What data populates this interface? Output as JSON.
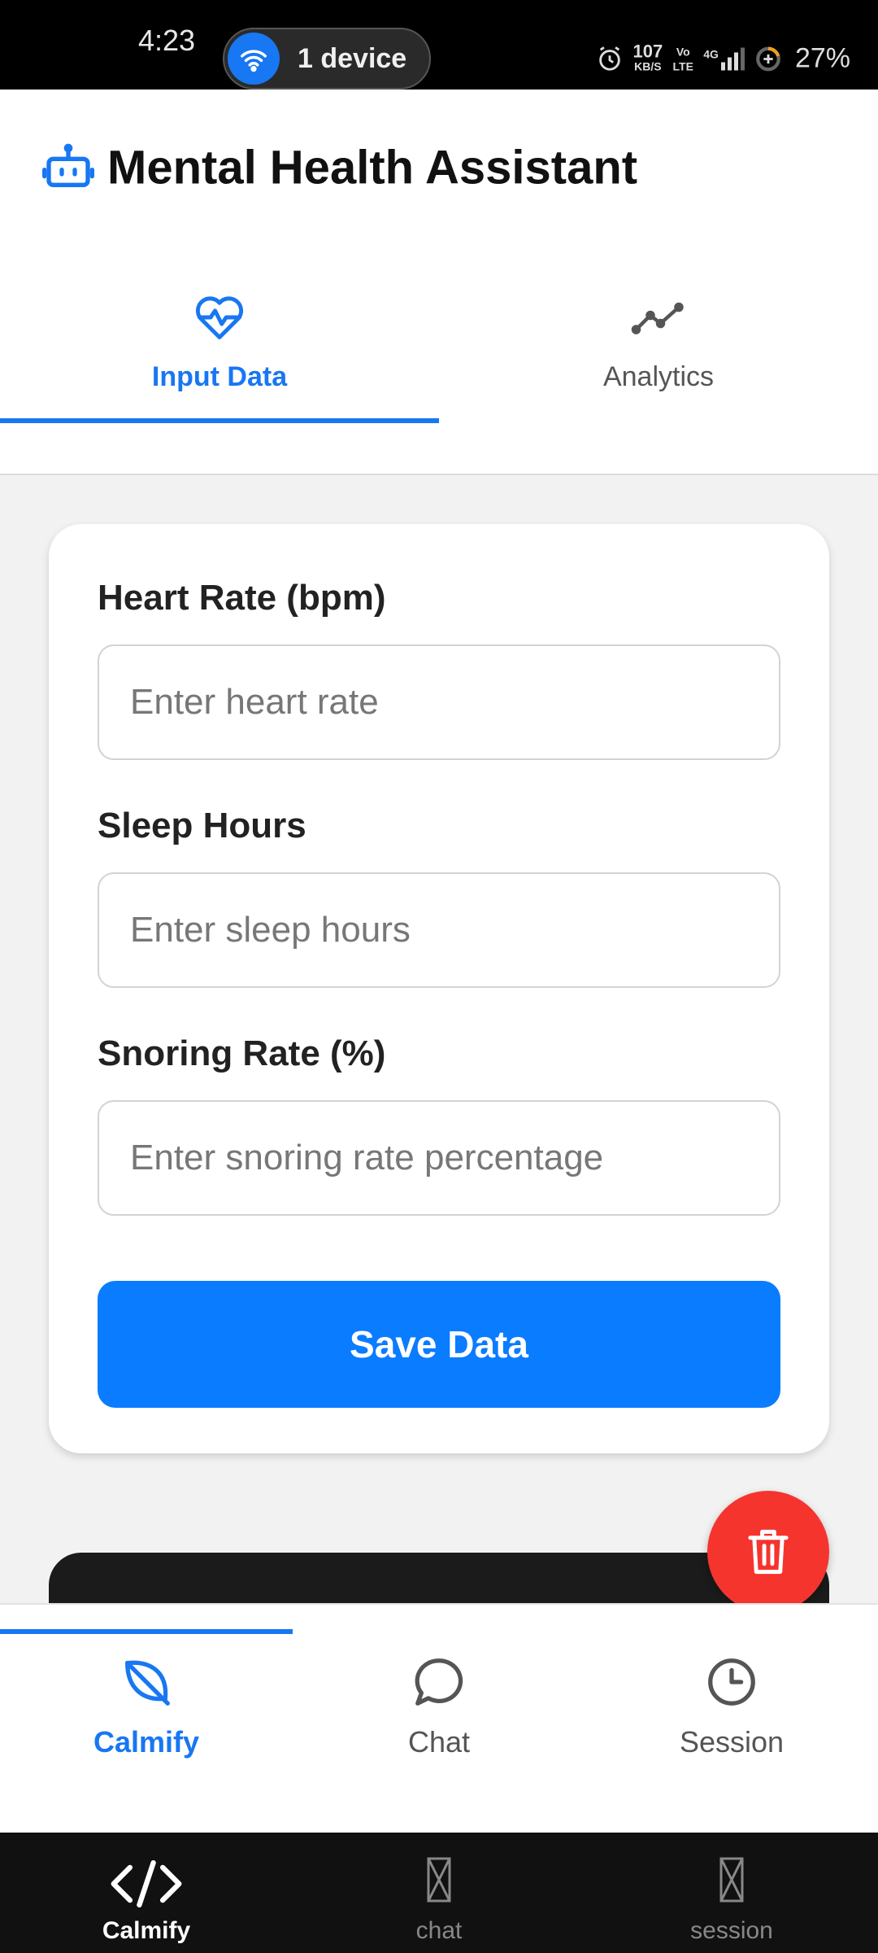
{
  "status_bar": {
    "time": "4:23",
    "device_pill": "1 device",
    "net_speed": "107",
    "net_unit": "KB/S",
    "volte": "Vo LTE",
    "signal": "4G",
    "battery": "27%"
  },
  "header": {
    "title": "Mental Health Assistant",
    "icon": "robot-icon"
  },
  "top_tabs": [
    {
      "label": "Input Data",
      "icon": "heart-pulse-icon",
      "active": true
    },
    {
      "label": "Analytics",
      "icon": "line-chart-icon",
      "active": false
    }
  ],
  "form": {
    "heart_rate": {
      "label": "Heart Rate (bpm)",
      "placeholder": "Enter heart rate",
      "value": ""
    },
    "sleep_hours": {
      "label": "Sleep Hours",
      "placeholder": "Enter sleep hours",
      "value": ""
    },
    "snoring_rate": {
      "label": "Snoring Rate (%)",
      "placeholder": "Enter snoring rate percentage",
      "value": ""
    },
    "save_label": "Save Data"
  },
  "fab": {
    "icon": "trash-icon"
  },
  "app_nav": [
    {
      "label": "Calmify",
      "icon": "leaf-icon",
      "active": true
    },
    {
      "label": "Chat",
      "icon": "chat-bubble-icon",
      "active": false
    },
    {
      "label": "Session",
      "icon": "clock-icon",
      "active": false
    }
  ],
  "system_nav": [
    {
      "label": "Calmify",
      "icon": "code-icon",
      "active": true
    },
    {
      "label": "chat",
      "icon": "missing-glyph-icon",
      "active": false
    },
    {
      "label": "session",
      "icon": "missing-glyph-icon",
      "active": false
    }
  ],
  "colors": {
    "accent": "#1877f2",
    "button": "#0a7cff",
    "danger": "#f5342e"
  }
}
